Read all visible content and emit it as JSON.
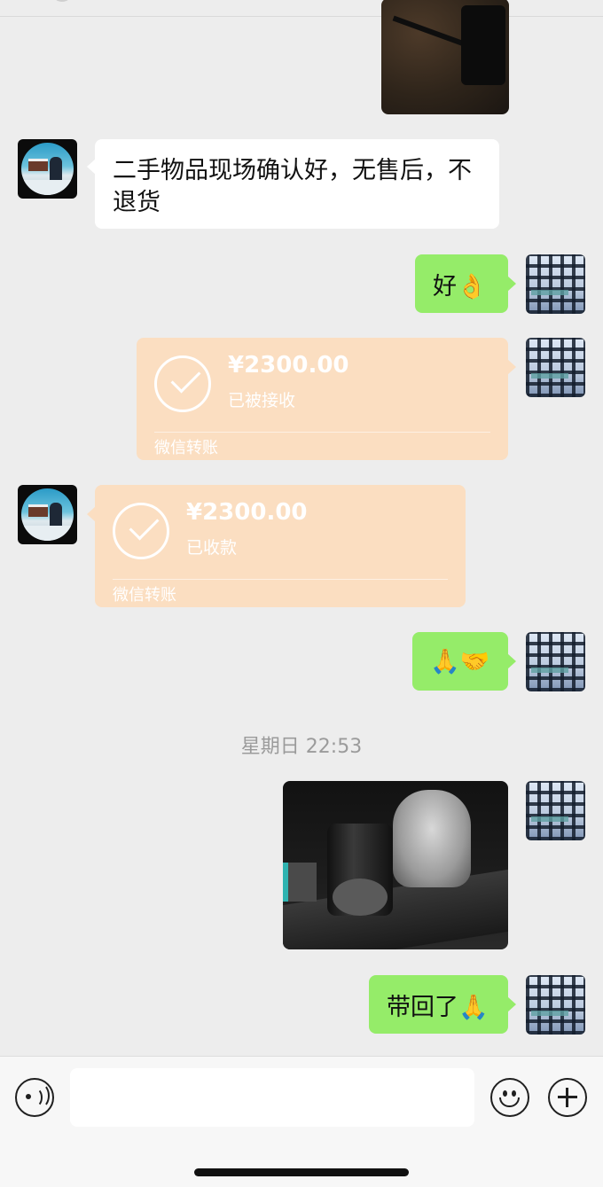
{
  "messages": {
    "peer_note": "二手物品现场确认好，无售后，不退货",
    "me_ok": "好👌",
    "me_thanks": "🙏🤝",
    "me_back": "带回了🙏"
  },
  "transfers": {
    "sent": {
      "amount": "¥2300.00",
      "status": "已被接收",
      "footer": "微信转账"
    },
    "received": {
      "amount": "¥2300.00",
      "status": "已收款",
      "footer": "微信转账"
    }
  },
  "timestamp": "星期日 22:53",
  "input": {
    "value": "",
    "placeholder": ""
  },
  "icons": {
    "voice": "voice-icon",
    "emoji": "emoji-icon",
    "plus": "plus-icon"
  },
  "colors": {
    "background": "#ededed",
    "green_bubble": "#95ec69",
    "white_bubble": "#ffffff",
    "transfer": "#fbdec1"
  }
}
